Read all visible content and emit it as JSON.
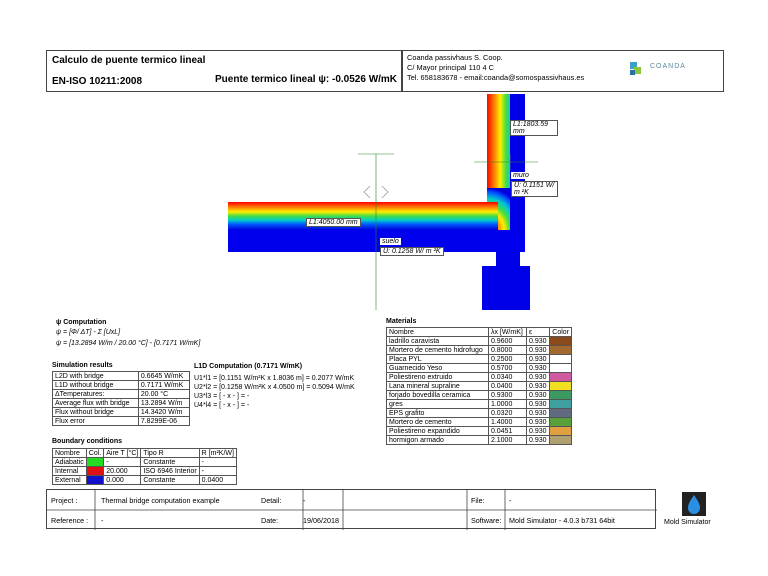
{
  "header": {
    "title": "Calculo de puente termico lineal",
    "standard": "EN-ISO 10211:2008",
    "psi_text": "Puente termico lineal ψ: -0.0526 W/mK",
    "company": "Coanda passivhaus S. Coop.",
    "address": "C/ Mayor principal 110 4 C",
    "contact": "Tel. 658183678  - email:coanda@somospassivhaus.es",
    "logo_text": "COANDA"
  },
  "drawing": {
    "label_l1_top": "L1:1803.59 mm",
    "label_muro": "muro",
    "label_u_muro": "U: 0.1151 W/ m ²K",
    "label_l1_left": "L1:4050.00 mm",
    "label_suelo": "suelo",
    "label_u_suelo": "U: 0.1258 W/ m ²K"
  },
  "psi": {
    "heading": "ψ Computation",
    "formula": "ψ = [Φ/ ΔT] - Σ [UxL]",
    "values": "ψ = [13.2894 W/m / 20.00 °C] - [0.7171 W/mK]"
  },
  "simulation": {
    "heading": "Simulation results",
    "rows": [
      [
        "L2D with bridge",
        "0.6645 W/mK"
      ],
      [
        "L1D without bridge",
        "0.7171 W/mK"
      ],
      [
        "ΔTemperatures:",
        "20.00 °C"
      ],
      [
        "Average flux with bridge",
        "13.2894 W/m"
      ],
      [
        "Flux without bridge",
        "14.3420 W/m"
      ],
      [
        "Flux error",
        "7.8299E-06"
      ]
    ]
  },
  "l1d": {
    "heading": "L1D Computation  (0.7171 W/mK)",
    "lines": [
      "U1*l1 = [0.1151 W/m²K x 1.8036 m] = 0.2077 W/mK",
      "U2*l2 = [0.1258 W/m²K x 4.0500 m] = 0.5094 W/mK",
      "U3*l3 = [ - x - ] = -",
      "U4*l4 = [ - x - ] = -"
    ]
  },
  "boundary": {
    "heading": "Boundary conditions",
    "headers": [
      "Nombre",
      "Col.",
      "Aire T [°C]",
      "Tipo R",
      "R [m²K/W]"
    ],
    "rows": [
      {
        "name": "Adiabatic",
        "color": "#22dd22",
        "t": "-",
        "tipo": "Constante",
        "r": "-"
      },
      {
        "name": "Internal",
        "color": "#dd1111",
        "t": "20.000",
        "tipo": "ISO 6946 Interior",
        "r": "-"
      },
      {
        "name": "External",
        "color": "#1111cc",
        "t": "0.000",
        "tipo": "Constante",
        "r": "0.0400"
      }
    ]
  },
  "materials": {
    "heading": "Materials",
    "headers": [
      "Nombre",
      "λx [W/mK]",
      "ε",
      "Color"
    ],
    "rows": [
      {
        "name": "ladrillo caravista",
        "l": "0.9600",
        "e": "0.930",
        "color": "#8b4a1c"
      },
      {
        "name": "Mortero de cemento hidrofugo",
        "l": "0.8000",
        "e": "0.930",
        "color": "#a06a30"
      },
      {
        "name": "Placa PYL",
        "l": "0.2500",
        "e": "0.930",
        "color": "#ffffff"
      },
      {
        "name": "Guarnecido Yeso",
        "l": "0.5700",
        "e": "0.930",
        "color": "#ffffff"
      },
      {
        "name": "Poliestireno extruido",
        "l": "0.0340",
        "e": "0.930",
        "color": "#d05aa0"
      },
      {
        "name": "Lana mineral supraline",
        "l": "0.0400",
        "e": "0.930",
        "color": "#f0e020"
      },
      {
        "name": "forjado bovedilla ceramica",
        "l": "0.9300",
        "e": "0.930",
        "color": "#3c9a60"
      },
      {
        "name": "gres",
        "l": "1.0000",
        "e": "0.930",
        "color": "#40a0a0"
      },
      {
        "name": "EPS grafito",
        "l": "0.0320",
        "e": "0.930",
        "color": "#606a80"
      },
      {
        "name": "Mortero de cemento",
        "l": "1.4000",
        "e": "0.930",
        "color": "#5aa03a"
      },
      {
        "name": "Poliestireno expandido",
        "l": "0.0451",
        "e": "0.930",
        "color": "#e0a040"
      },
      {
        "name": "hormigon armado",
        "l": "2.1000",
        "e": "0.930",
        "color": "#b0a070"
      }
    ]
  },
  "footer": {
    "project_label": "Project :",
    "project_value": "Thermal bridge computation example",
    "detail_label": "Detail:",
    "detail_value": "-",
    "file_label": "File:",
    "file_value": "-",
    "reference_label": "Reference :",
    "reference_value": "-",
    "date_label": "Date:",
    "date_value": "19/06/2018",
    "software_label": "Software:",
    "software_value": "Mold Simulator - 4.0.3 b731 64bit",
    "brand": "Mold Simulator"
  }
}
